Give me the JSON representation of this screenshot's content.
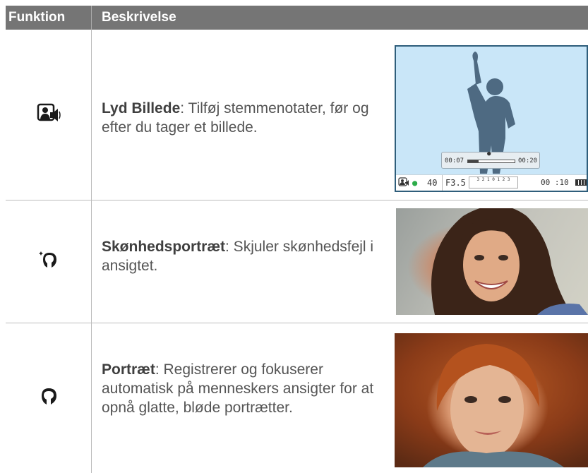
{
  "table": {
    "headers": {
      "function": "Funktion",
      "description": "Beskrivelse"
    },
    "rows": [
      {
        "icon": "voice-picture-icon",
        "title": "Lyd Billede",
        "text": ": Tilføj stemmenotater, før og efter du tager et billede."
      },
      {
        "icon": "beauty-portrait-icon",
        "title": "Skønhedsportræt",
        "text": ": Skjuler skønhedsfejl i ansigtet."
      },
      {
        "icon": "portrait-icon",
        "title": "Portræt",
        "text": ": Registrerer og fokuserer automatisk på menneskers ansigter for at opnå glatte, bløde portrætter."
      }
    ]
  },
  "camera_screen": {
    "time_elapsed": "00:07",
    "time_total": "00:20",
    "iso": "40",
    "aperture": "F3.5",
    "ev_scale": "3 2 1 0 1 2 3",
    "shots": "00 :10",
    "playback_progress": 0.22
  },
  "colors": {
    "header_bg": "#757575",
    "lcd_bg": "#c9e6f8",
    "lcd_border": "#2f5e7b",
    "silhouette": "#4e6a82"
  }
}
